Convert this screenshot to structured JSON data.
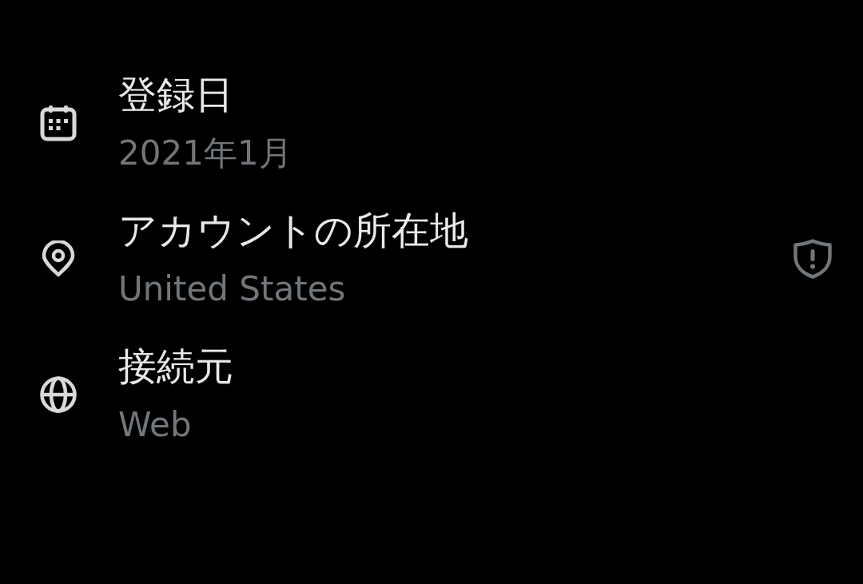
{
  "items": [
    {
      "kind": "calendar",
      "label": "登録日",
      "value": "2021年1月",
      "warning": false
    },
    {
      "kind": "location",
      "label": "アカウントの所在地",
      "value": "United States",
      "warning": true
    },
    {
      "kind": "globe",
      "label": "接続元",
      "value": "Web",
      "warning": false
    }
  ]
}
